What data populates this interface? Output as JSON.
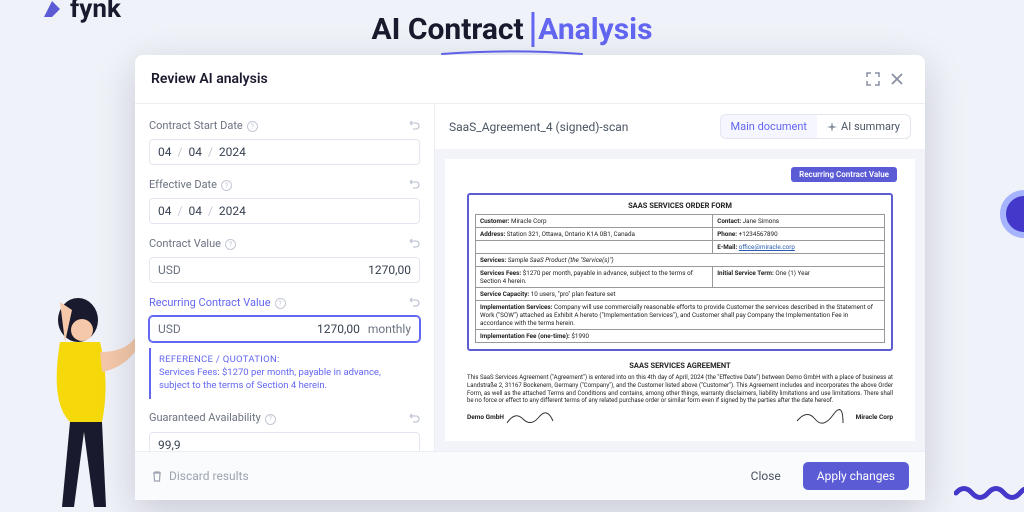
{
  "brand": "fynk",
  "hero": {
    "prefix": "AI Contract ",
    "highlight": "Analysis"
  },
  "modal": {
    "title": "Review AI analysis",
    "discard": "Discard results",
    "close": "Close",
    "apply": "Apply changes"
  },
  "form": {
    "contractStartDate": {
      "label": "Contract Start Date",
      "day": "04",
      "month": "04",
      "year": "2024"
    },
    "effectiveDate": {
      "label": "Effective Date",
      "day": "04",
      "month": "04",
      "year": "2024"
    },
    "contractValue": {
      "label": "Contract Value",
      "currency": "USD",
      "amount": "1270,00"
    },
    "recurringValue": {
      "label": "Recurring Contract Value",
      "currency": "USD",
      "amount": "1270,00",
      "frequency": "monthly",
      "refLabel": "REFERENCE / QUOTATION:",
      "refText": "Services Fees: $1270 per month, payable in advance, subject to the terms of Section 4 herein."
    },
    "guaranteedAvailability": {
      "label": "Guaranteed Availability",
      "value": "99,9"
    }
  },
  "doc": {
    "filename": "SaaS_Agreement_4 (signed)-scan",
    "tabs": {
      "main": "Main document",
      "summary": "AI summary"
    },
    "highlightBadge": "Recurring Contract Value",
    "order": {
      "title": "SAAS SERVICES ORDER FORM",
      "customer": "Miracle Corp",
      "contact": "Jane Simons",
      "address": "Station 321, Ottawa, Ontario K1A 0B1, Canada",
      "phone": "+1234567890",
      "email": "office@miracle.corp",
      "services": "Sample SaaS Product (the \"Service(s)\")",
      "fees": "$1270 per month, payable in advance, subject to the terms of Section 4 herein.",
      "term": "One (1) Year",
      "capacity": "10 users, \"pro\" plan feature set",
      "implementation": "Company will use commercially reasonable efforts to provide Customer the services described in the Statement of Work (\"SOW\") attached as Exhibit A hereto (\"Implementation Services\"), and Customer shall pay Company the Implementation Fee in accordance with the terms herein.",
      "implFee": "$1990"
    },
    "agreement": {
      "title": "SAAS SERVICES AGREEMENT",
      "body": "This SaaS Services Agreement (\"Agreement\") is entered into on this 4th day of April, 2024 (the \"Effective Date\") between Demo GmbH with a place of business at Landstraße 2, 31167 Bockenem, Germany (\"Company\"), and the Customer listed above (\"Customer\"). This Agreement includes and incorporates the above Order Form, as well as the attached Terms and Conditions and contains, among other things, warranty disclaimers, liability limitations and use limitations. There shall be no force or effect to any different terms of any related purchase order or similar form even if signed by the parties after the date hereof.",
      "sigLeft": "Demo GmbH",
      "sigRight": "Miracle Corp"
    }
  }
}
